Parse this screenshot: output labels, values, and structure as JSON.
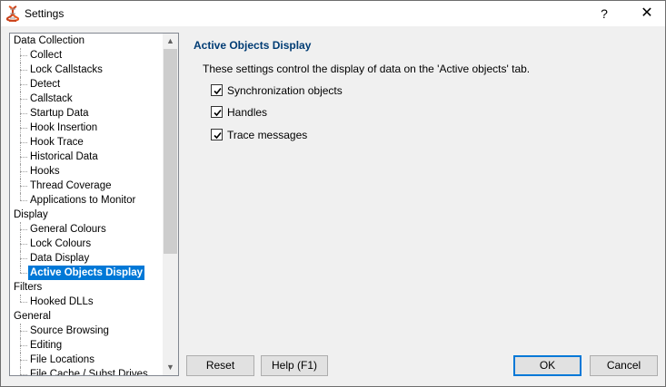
{
  "window": {
    "title": "Settings",
    "help_glyph": "?",
    "close_glyph": "✕"
  },
  "tree": {
    "items": [
      {
        "label": "Data Collection",
        "level": 0
      },
      {
        "label": "Collect",
        "level": 1
      },
      {
        "label": "Lock Callstacks",
        "level": 1
      },
      {
        "label": "Detect",
        "level": 1
      },
      {
        "label": "Callstack",
        "level": 1
      },
      {
        "label": "Startup Data",
        "level": 1
      },
      {
        "label": "Hook Insertion",
        "level": 1
      },
      {
        "label": "Hook Trace",
        "level": 1
      },
      {
        "label": "Historical Data",
        "level": 1
      },
      {
        "label": "Hooks",
        "level": 1
      },
      {
        "label": "Thread Coverage",
        "level": 1
      },
      {
        "label": "Applications to Monitor",
        "level": 1
      },
      {
        "label": "Display",
        "level": 0
      },
      {
        "label": "General Colours",
        "level": 1
      },
      {
        "label": "Lock Colours",
        "level": 1
      },
      {
        "label": "Data Display",
        "level": 1
      },
      {
        "label": "Active Objects Display",
        "level": 1,
        "selected": true
      },
      {
        "label": "Filters",
        "level": 0
      },
      {
        "label": "Hooked DLLs",
        "level": 1
      },
      {
        "label": "General",
        "level": 0
      },
      {
        "label": "Source Browsing",
        "level": 1
      },
      {
        "label": "Editing",
        "level": 1
      },
      {
        "label": "File Locations",
        "level": 1
      },
      {
        "label": "File Cache / Subst Drives",
        "level": 1
      }
    ],
    "scroll_up_glyph": "▲",
    "scroll_down_glyph": "▼"
  },
  "panel": {
    "title": "Active Objects Display",
    "description": "These settings control the display of data on the 'Active objects' tab.",
    "options": [
      {
        "label": "Synchronization objects",
        "checked": true
      },
      {
        "label": "Handles",
        "checked": true
      },
      {
        "label": "Trace messages",
        "checked": true
      }
    ]
  },
  "buttons": {
    "reset": "Reset",
    "help": "Help (F1)",
    "ok": "OK",
    "cancel": "Cancel"
  },
  "colors": {
    "selection": "#0078d7",
    "panel_title": "#003c74"
  }
}
